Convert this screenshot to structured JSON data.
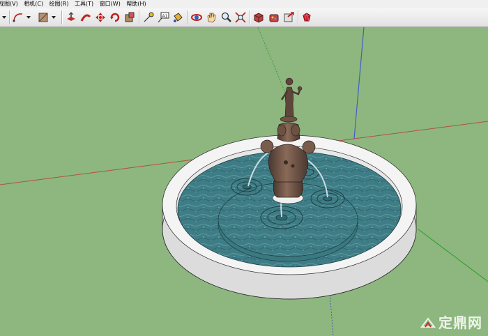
{
  "menu": {
    "items": [
      "视图(V)",
      "相机(C)",
      "绘图(R)",
      "工具(T)",
      "窗口(W)",
      "帮助(H)"
    ]
  },
  "toolbar": {
    "tools": [
      "select-arrow-dropdown",
      "arc-tool",
      "arc-dropdown",
      "shape-tool",
      "shape-dropdown",
      "push-pull-tool",
      "follow-me-tool",
      "move-tool",
      "rotate-tool",
      "scale-tool",
      "tape-measure-tool",
      "text-tool",
      "paint-bucket-tool",
      "orbit-tool",
      "pan-tool",
      "zoom-tool",
      "zoom-extents-tool",
      "components-tool",
      "materials-tool",
      "share-model-tool",
      "ruby-tool"
    ]
  },
  "scene": {
    "ground_color": "#8db77e",
    "water_color": "#3f7d86",
    "rim_color": "#f2f2f2",
    "statue_color": "#6e5548"
  },
  "watermark": {
    "text": "定鼎网"
  }
}
